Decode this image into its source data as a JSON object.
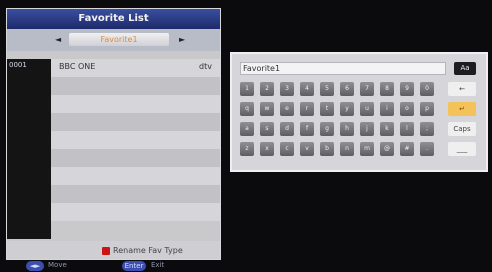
{
  "favorite_list": {
    "title": "Favorite List",
    "group": "Favorite1",
    "rows": [
      {
        "num": "0001",
        "name": "BBC ONE",
        "flag": "dtv"
      },
      {
        "num": "",
        "name": "",
        "flag": ""
      },
      {
        "num": "",
        "name": "",
        "flag": ""
      },
      {
        "num": "",
        "name": "",
        "flag": ""
      },
      {
        "num": "",
        "name": "",
        "flag": ""
      },
      {
        "num": "",
        "name": "",
        "flag": ""
      },
      {
        "num": "",
        "name": "",
        "flag": ""
      },
      {
        "num": "",
        "name": "",
        "flag": ""
      },
      {
        "num": "",
        "name": "",
        "flag": ""
      }
    ],
    "footer_label": "Rename Fav Type"
  },
  "help": {
    "move_key": "◄►",
    "move_label": "Move",
    "enter_key": "Enter",
    "exit_label": "Exit"
  },
  "keyboard": {
    "input_value": "Favorite1",
    "mode": "Aa",
    "rows": [
      [
        "1",
        "2",
        "3",
        "4",
        "5",
        "6",
        "7",
        "8",
        "9",
        "0"
      ],
      [
        "q",
        "w",
        "e",
        "r",
        "t",
        "y",
        "u",
        "i",
        "o",
        "p"
      ],
      [
        "a",
        "s",
        "d",
        "f",
        "g",
        "h",
        "j",
        "k",
        "l",
        ";"
      ],
      [
        "z",
        "x",
        "c",
        "v",
        "b",
        "n",
        "m",
        "@",
        "#",
        "."
      ]
    ],
    "side_keys": [
      "←",
      "↵",
      "Caps",
      "___"
    ]
  }
}
